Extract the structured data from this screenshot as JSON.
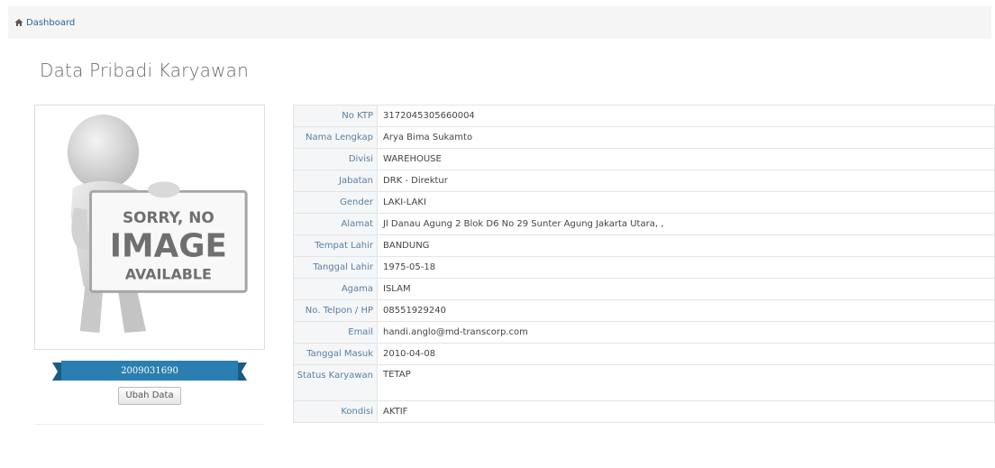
{
  "breadcrumb": {
    "label": "Dashboard"
  },
  "page": {
    "title": "Data Pribadi Karyawan"
  },
  "photo": {
    "placeholder_line1": "SORRY, NO",
    "placeholder_line2": "IMAGE",
    "placeholder_line3": "AVAILABLE"
  },
  "employee": {
    "nik": "2009031690"
  },
  "actions": {
    "edit_label": "Ubah Data"
  },
  "colors": {
    "ribbon": "#2a7fb0",
    "ribbon_dark": "#1c5c82",
    "label_text": "#5b7f9e",
    "link": "#2a6496"
  },
  "details": [
    {
      "label": "No KTP",
      "value": "3172045305660004"
    },
    {
      "label": "Nama Lengkap",
      "value": "Arya Bima Sukamto"
    },
    {
      "label": "Divisi",
      "value": "WAREHOUSE"
    },
    {
      "label": "Jabatan",
      "value": "DRK - Direktur"
    },
    {
      "label": "Gender",
      "value": "LAKI-LAKI"
    },
    {
      "label": "Alamat",
      "value": "Jl Danau Agung 2 Blok D6 No 29 Sunter Agung Jakarta Utara, ,"
    },
    {
      "label": "Tempat Lahir",
      "value": "BANDUNG"
    },
    {
      "label": "Tanggal Lahir",
      "value": "1975-05-18"
    },
    {
      "label": "Agama",
      "value": "ISLAM"
    },
    {
      "label": "No. Telpon / HP",
      "value": "08551929240"
    },
    {
      "label": "Email",
      "value": "handi.anglo@md-transcorp.com"
    },
    {
      "label": "Tanggal Masuk",
      "value": "2010-04-08"
    },
    {
      "label": "Status Karyawan",
      "value": "TETAP"
    },
    {
      "label": "Kondisi",
      "value": "AKTIF"
    }
  ]
}
